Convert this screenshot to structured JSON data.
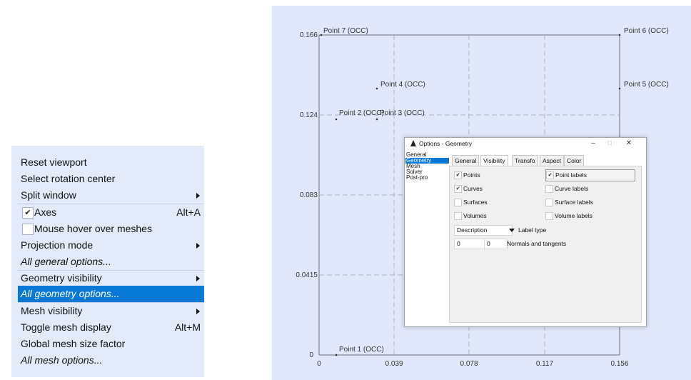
{
  "menu": {
    "items": [
      {
        "label": "Reset viewport"
      },
      {
        "label": "Select rotation center"
      },
      {
        "label": "Split window",
        "submenu": true
      },
      {
        "label": "Axes",
        "shortcut": "Alt+A",
        "checked": true
      },
      {
        "label": "Mouse hover over meshes",
        "checked": false
      },
      {
        "label": "Projection mode",
        "submenu": true
      },
      {
        "label": "All general options..."
      },
      {
        "label": "Geometry visibility",
        "submenu": true
      },
      {
        "label": "All geometry options...",
        "selected": true
      },
      {
        "label": "Mesh visibility",
        "submenu": true
      },
      {
        "label": "Toggle mesh display",
        "shortcut": "Alt+M"
      },
      {
        "label": "Global mesh size factor"
      },
      {
        "label": "All mesh options..."
      }
    ],
    "check_mark": "✔"
  },
  "viewport": {
    "y_ticks": [
      "0.166",
      "0.124",
      "0.083",
      "0.0415",
      "0"
    ],
    "x_ticks": [
      "0",
      "0.039",
      "0.078",
      "0.117",
      "0.156"
    ],
    "points": [
      {
        "label": "Point 7 (OCC)"
      },
      {
        "label": "Point 6 (OCC)"
      },
      {
        "label": "Point 4 (OCC)"
      },
      {
        "label": "Point 5 (OCC)"
      },
      {
        "label": "Point 2 (OCC)"
      },
      {
        "label": "Point 3 (OCC)"
      },
      {
        "label": "Point 1 (OCC)"
      }
    ]
  },
  "dialog": {
    "title": "Options - Geometry",
    "window_buttons": {
      "minimize": "–",
      "maximize": "□",
      "close": "✕"
    },
    "categories": [
      "General",
      "Geometry",
      "Mesh",
      "Solver",
      "Post-pro"
    ],
    "selected_category": "Geometry",
    "tabs": [
      "General",
      "Visibility",
      "Transfo",
      "Aspect",
      "Color"
    ],
    "active_tab": "Visibility",
    "options_left": [
      {
        "label": "Points",
        "checked": true
      },
      {
        "label": "Curves",
        "checked": true
      },
      {
        "label": "Surfaces",
        "checked": false
      },
      {
        "label": "Volumes",
        "checked": false
      }
    ],
    "options_right": [
      {
        "label": "Point labels",
        "checked": true
      },
      {
        "label": "Curve labels",
        "checked": false
      },
      {
        "label": "Surface labels",
        "checked": false
      },
      {
        "label": "Volume labels",
        "checked": false
      }
    ],
    "label_type": {
      "value": "Description",
      "caption": "Label type"
    },
    "normals": {
      "value1": "0",
      "value2": "0",
      "caption": "Normals and tangents"
    }
  }
}
